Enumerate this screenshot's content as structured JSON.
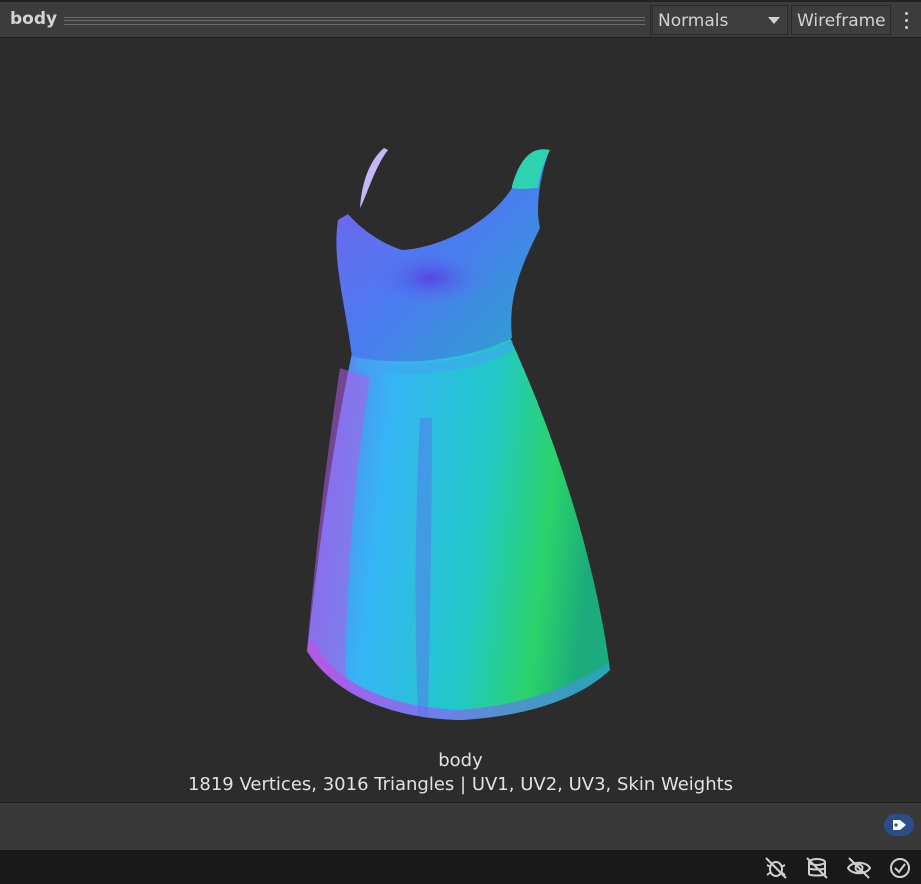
{
  "header": {
    "title": "body",
    "shading_dropdown": {
      "selected": "Normals"
    },
    "wireframe_label": "Wireframe"
  },
  "preview": {
    "mesh_name": "body",
    "mesh_stats": "1819 Vertices, 3016 Triangles | UV1, UV2, UV3, Skin Weights"
  },
  "icons": {
    "menu": "more-vertical-icon",
    "label_tag": "tag-icon",
    "status": [
      "bug-icon",
      "stack-icon",
      "eye-off-icon",
      "check-circle-icon"
    ]
  },
  "colors": {
    "background": "#2c2c2c",
    "toolbar": "#3c3c3c",
    "tag_accent": "#2a4f86",
    "normals_blue": "#6a5cf0",
    "normals_cyan": "#22c8c8",
    "normals_green": "#2bd36a",
    "normals_magenta": "#d04ee8"
  }
}
